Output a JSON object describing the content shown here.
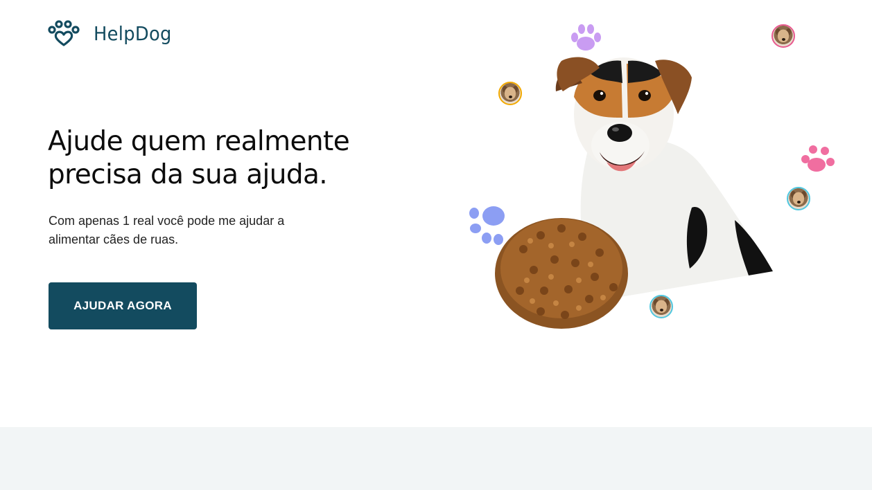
{
  "brand": {
    "name": "HelpDog",
    "logo_icon": "paw-heart-icon"
  },
  "hero": {
    "headline_line1": "Ajude quem realmente",
    "headline_line2": "precisa da sua ajuda.",
    "subtext_line1": "Com apenas 1 real você pode me ajudar a",
    "subtext_line2": "alimentar cães de ruas.",
    "cta_label": "AJUDAR AGORA"
  },
  "colors": {
    "primary": "#134b5f",
    "headline": "#0c0c0c",
    "footer_band": "#f2f5f6",
    "paw_purple": "#c99cf2",
    "paw_pink": "#f06ea0",
    "paw_blue": "#8c9ef3",
    "avatar_ring_orange": "#f2a900",
    "avatar_ring_pink": "#e85a8f",
    "avatar_ring_cyan": "#4fc7e0"
  },
  "illustration": {
    "main_image": "jack-russell-dog-with-kibble",
    "decorations": [
      "paw-print-icon",
      "paw-print-icon",
      "paw-print-icon"
    ],
    "avatars": [
      "dog-avatar",
      "dog-avatar",
      "dog-avatar",
      "dog-avatar"
    ]
  }
}
